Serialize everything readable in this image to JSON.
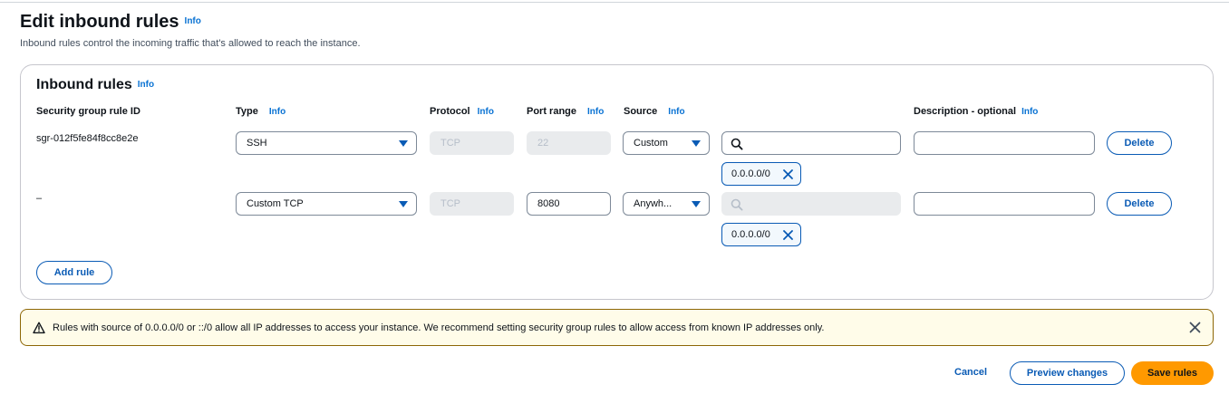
{
  "header": {
    "title": "Edit inbound rules",
    "info": "Info",
    "description": "Inbound rules control the incoming traffic that's allowed to reach the instance."
  },
  "panel": {
    "title": "Inbound rules",
    "info": "Info",
    "columns": {
      "rule_id": "Security group rule ID",
      "type": "Type",
      "protocol": "Protocol",
      "port_range": "Port range",
      "source": "Source",
      "description": "Description - optional",
      "info": "Info"
    },
    "rows": [
      {
        "rule_id": "sgr-012f5fe84f8cc8e2e",
        "type": "SSH",
        "protocol": "TCP",
        "port_range": "22",
        "source": "Custom",
        "search_value": "",
        "token": "0.0.0.0/0",
        "description": "",
        "delete_label": "Delete"
      },
      {
        "rule_id": "–",
        "type": "Custom TCP",
        "protocol": "TCP",
        "port_range": "8080",
        "source": "Anywh...",
        "search_value": "",
        "token": "0.0.0.0/0",
        "description": "",
        "delete_label": "Delete"
      }
    ],
    "add_rule_label": "Add rule"
  },
  "alert": {
    "text": "Rules with source of 0.0.0.0/0 or ::/0 allow all IP addresses to access your instance. We recommend setting security group rules to allow access from known IP addresses only."
  },
  "footer": {
    "cancel_label": "Cancel",
    "preview_label": "Preview changes",
    "save_label": "Save rules"
  },
  "colors": {
    "link": "#0a5bb5",
    "primary": "#ff9900",
    "warning_border": "#8d6605",
    "warning_bg": "#fffce9"
  }
}
